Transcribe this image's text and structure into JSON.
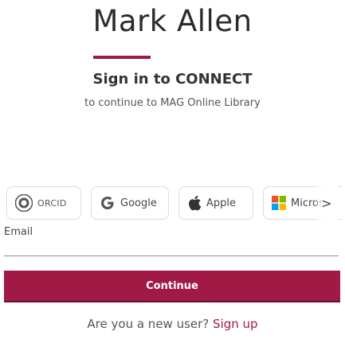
{
  "brand": {
    "title": "Mark Allen",
    "accent_color": "#a01843"
  },
  "signin": {
    "heading": "Sign in to CONNECT",
    "subheading": "to continue to MAG Online Library"
  },
  "providers": [
    {
      "id": "orcid",
      "label": "ORCID",
      "icon": "orcid-icon"
    },
    {
      "id": "google",
      "label": "Google",
      "icon": "google-icon"
    },
    {
      "id": "apple",
      "label": "Apple",
      "icon": "apple-icon"
    },
    {
      "id": "microsoft",
      "label": "Micros",
      "icon": "microsoft-icon"
    }
  ],
  "more_providers_glyph": ">",
  "email": {
    "label": "Email",
    "value": "",
    "placeholder": ""
  },
  "continue_label": "Continue",
  "signup": {
    "prompt": "Are you a new user?",
    "link_label": "Sign up"
  },
  "colors": {
    "button_bg": "#a11a46",
    "orcid_green": "#a6ce39",
    "google_blue": "#4285F4",
    "microsoft_red": "#F25022",
    "microsoft_green": "#7FBA00",
    "microsoft_blue": "#00A4EF",
    "microsoft_yellow": "#FFB900"
  }
}
